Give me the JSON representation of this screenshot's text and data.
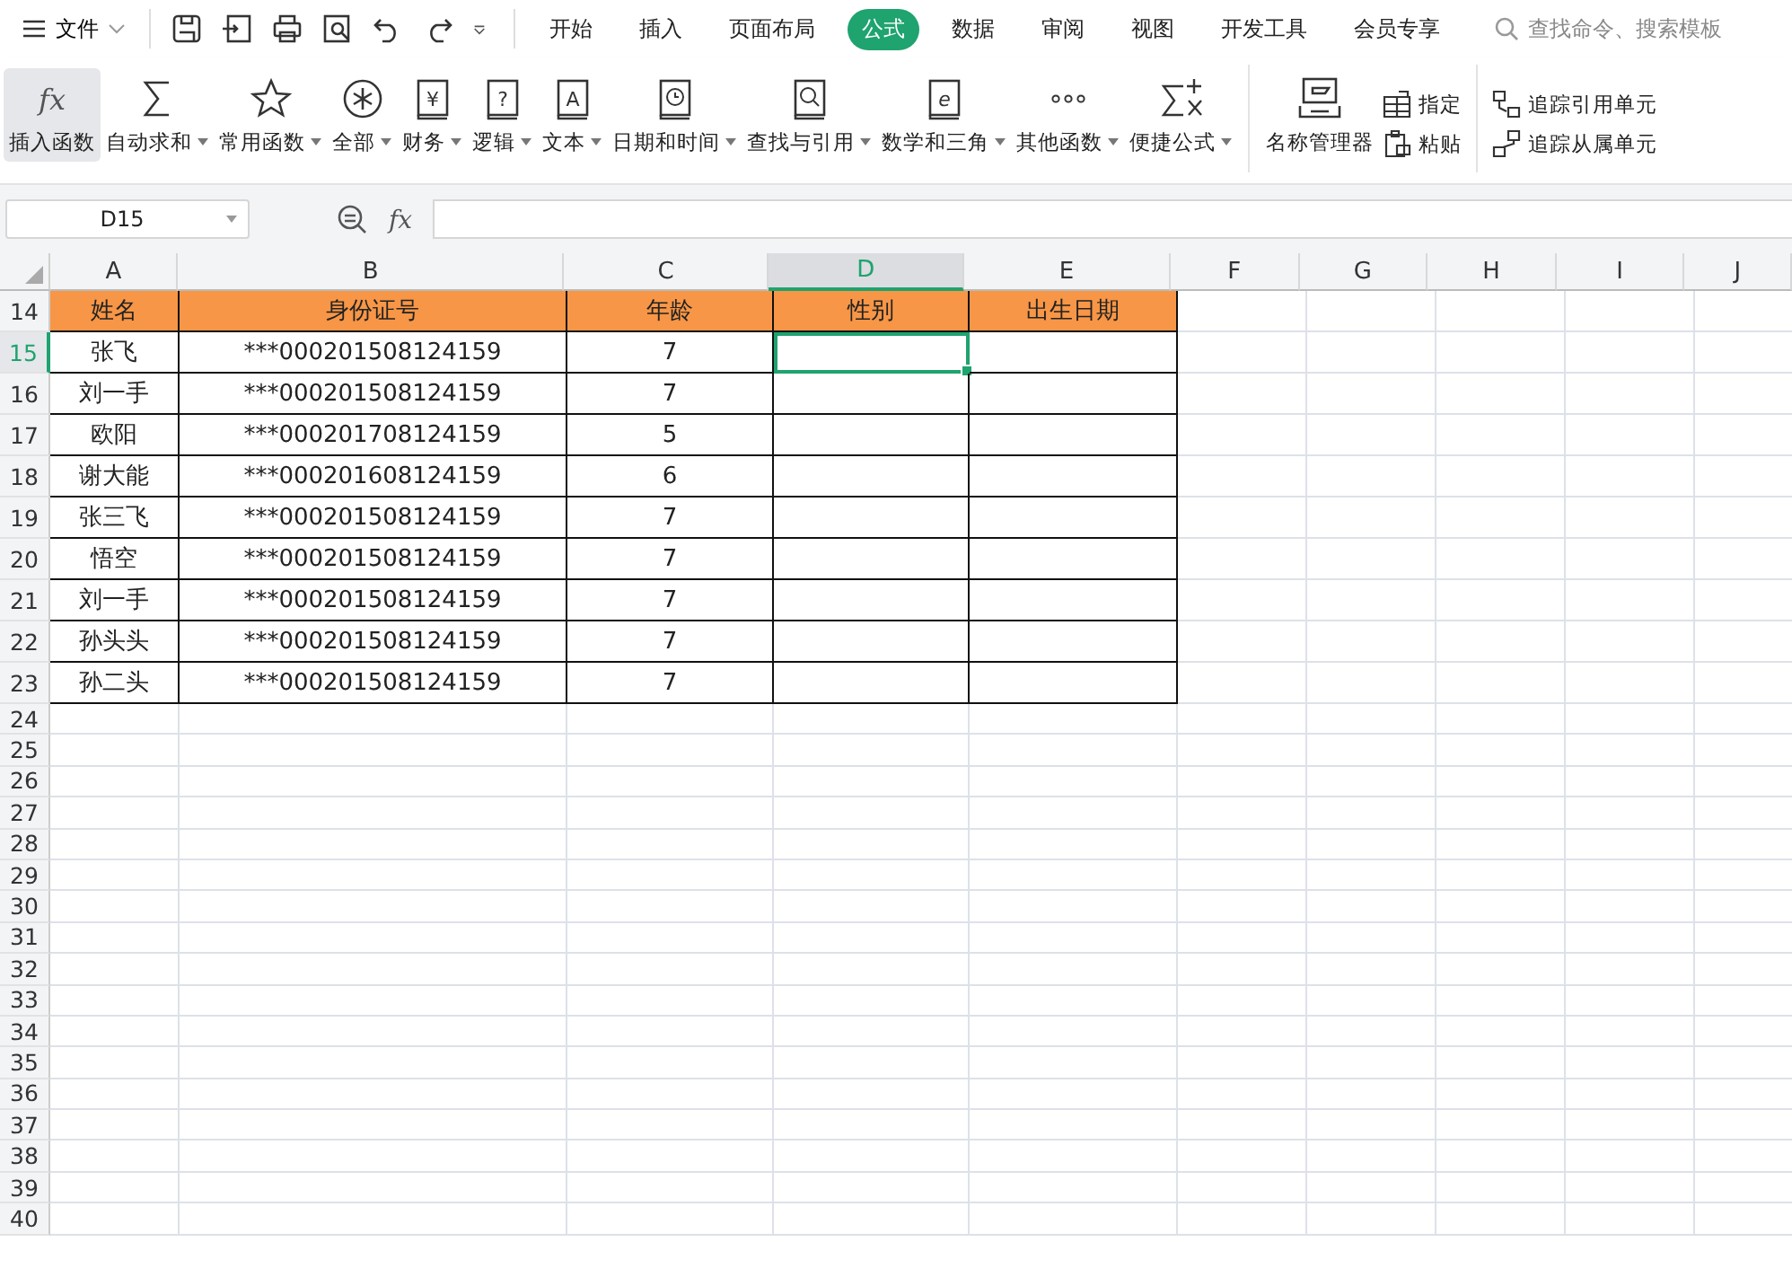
{
  "file_menu": {
    "label": "文件"
  },
  "menu_tabs": [
    {
      "label": "开始",
      "selected": false
    },
    {
      "label": "插入",
      "selected": false
    },
    {
      "label": "页面布局",
      "selected": false
    },
    {
      "label": "公式",
      "selected": true
    },
    {
      "label": "数据",
      "selected": false
    },
    {
      "label": "审阅",
      "selected": false
    },
    {
      "label": "视图",
      "selected": false
    },
    {
      "label": "开发工具",
      "selected": false
    },
    {
      "label": "会员专享",
      "selected": false
    }
  ],
  "search": {
    "placeholder": "查找命令、搜索模板"
  },
  "ribbon": [
    {
      "label": "插入函数",
      "dropdown": false,
      "highlighted": true,
      "glyph": "fx"
    },
    {
      "label": "自动求和",
      "dropdown": true,
      "highlighted": false
    },
    {
      "label": "常用函数",
      "dropdown": true,
      "highlighted": false
    },
    {
      "label": "全部",
      "dropdown": true,
      "highlighted": false
    },
    {
      "label": "财务",
      "dropdown": true,
      "highlighted": false,
      "glyph": "¥"
    },
    {
      "label": "逻辑",
      "dropdown": true,
      "highlighted": false,
      "glyph": "?"
    },
    {
      "label": "文本",
      "dropdown": true,
      "highlighted": false,
      "glyph": "A"
    },
    {
      "label": "日期和时间",
      "dropdown": true,
      "highlighted": false
    },
    {
      "label": "查找与引用",
      "dropdown": true,
      "highlighted": false
    },
    {
      "label": "数学和三角",
      "dropdown": true,
      "highlighted": false,
      "glyph": "e"
    },
    {
      "label": "其他函数",
      "dropdown": true,
      "highlighted": false
    },
    {
      "label": "便捷公式",
      "dropdown": true,
      "highlighted": false
    },
    {
      "label": "名称管理器",
      "dropdown": false,
      "highlighted": false
    }
  ],
  "ribbon_small": [
    {
      "label": "指定"
    },
    {
      "label": "粘贴"
    }
  ],
  "ribbon_trace": [
    {
      "label": "追踪引用单元"
    },
    {
      "label": "追踪从属单元"
    }
  ],
  "name_box": {
    "value": "D15"
  },
  "formula_bar": {
    "glyph": "fx"
  },
  "columns": [
    {
      "label": "A",
      "selected": false
    },
    {
      "label": "B",
      "selected": false
    },
    {
      "label": "C",
      "selected": false
    },
    {
      "label": "D",
      "selected": true
    },
    {
      "label": "E",
      "selected": false
    },
    {
      "label": "F",
      "selected": false
    },
    {
      "label": "G",
      "selected": false
    },
    {
      "label": "H",
      "selected": false
    },
    {
      "label": "I",
      "selected": false
    },
    {
      "label": "J",
      "selected": false
    }
  ],
  "rows": [
    {
      "number": "14",
      "kind": "header",
      "selected": false,
      "cells": [
        "姓名",
        "身份证号",
        "年龄",
        "性别",
        "出生日期"
      ]
    },
    {
      "number": "15",
      "kind": "data",
      "selected": true,
      "cells": [
        "张飞",
        "***000201508124159",
        "7"
      ]
    },
    {
      "number": "16",
      "kind": "data",
      "selected": false,
      "cells": [
        "刘一手",
        "***000201508124159",
        "7"
      ]
    },
    {
      "number": "17",
      "kind": "data",
      "selected": false,
      "cells": [
        "欧阳",
        "***000201708124159",
        "5"
      ]
    },
    {
      "number": "18",
      "kind": "data",
      "selected": false,
      "cells": [
        "谢大能",
        "***000201608124159",
        "6"
      ]
    },
    {
      "number": "19",
      "kind": "data",
      "selected": false,
      "cells": [
        "张三飞",
        "***000201508124159",
        "7"
      ]
    },
    {
      "number": "20",
      "kind": "data",
      "selected": false,
      "cells": [
        "悟空",
        "***000201508124159",
        "7"
      ]
    },
    {
      "number": "21",
      "kind": "data",
      "selected": false,
      "cells": [
        "刘一手",
        "***000201508124159",
        "7"
      ]
    },
    {
      "number": "22",
      "kind": "data",
      "selected": false,
      "cells": [
        "孙头头",
        "***000201508124159",
        "7"
      ]
    },
    {
      "number": "23",
      "kind": "data",
      "selected": false,
      "cells": [
        "孙二头",
        "***000201508124159",
        "7"
      ]
    },
    {
      "number": "24",
      "kind": "empty",
      "selected": false
    },
    {
      "number": "25",
      "kind": "empty",
      "selected": false
    },
    {
      "number": "26",
      "kind": "empty",
      "selected": false
    },
    {
      "number": "27",
      "kind": "empty",
      "selected": false
    },
    {
      "number": "28",
      "kind": "empty",
      "selected": false
    },
    {
      "number": "29",
      "kind": "empty",
      "selected": false
    },
    {
      "number": "30",
      "kind": "empty",
      "selected": false
    },
    {
      "number": "31",
      "kind": "empty",
      "selected": false
    },
    {
      "number": "32",
      "kind": "empty",
      "selected": false
    },
    {
      "number": "33",
      "kind": "empty",
      "selected": false
    },
    {
      "number": "34",
      "kind": "empty",
      "selected": false
    },
    {
      "number": "35",
      "kind": "empty",
      "selected": false
    },
    {
      "number": "36",
      "kind": "empty",
      "selected": false
    },
    {
      "number": "37",
      "kind": "empty",
      "selected": false
    },
    {
      "number": "38",
      "kind": "empty",
      "selected": false
    },
    {
      "number": "39",
      "kind": "empty",
      "selected": false
    },
    {
      "number": "40",
      "kind": "empty",
      "selected": false
    }
  ]
}
